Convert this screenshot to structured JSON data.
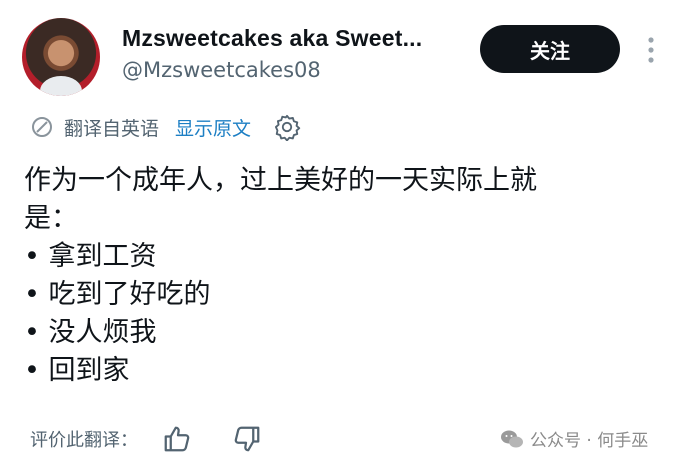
{
  "author": {
    "display_name": "Mzsweetcakes aka Sweet...",
    "handle": "@Mzsweetcakes08",
    "avatar_icon": "avatar-photo"
  },
  "actions": {
    "follow_label": "关注",
    "more_icon": "more-vertical-icon"
  },
  "translation": {
    "translated_from": "翻译自英语",
    "show_original": "显示原文",
    "settings_icon": "gear-icon"
  },
  "tweet": {
    "lines": [
      "作为一个成年人，过上美好的一天实际上就",
      "是：",
      "• 拿到工资",
      "• 吃到了好吃的",
      "• 没人烦我",
      "• 回到家"
    ]
  },
  "rating": {
    "label": "评价此翻译：",
    "thumbs_up_icon": "thumbs-up-icon",
    "thumbs_down_icon": "thumbs-down-icon"
  },
  "watermark": {
    "text": "公众号 · 何手巫",
    "icon": "wechat-icon"
  },
  "colors": {
    "button_bg": "#0f1419",
    "link": "#1d7fc4",
    "secondary_text": "#536471"
  }
}
